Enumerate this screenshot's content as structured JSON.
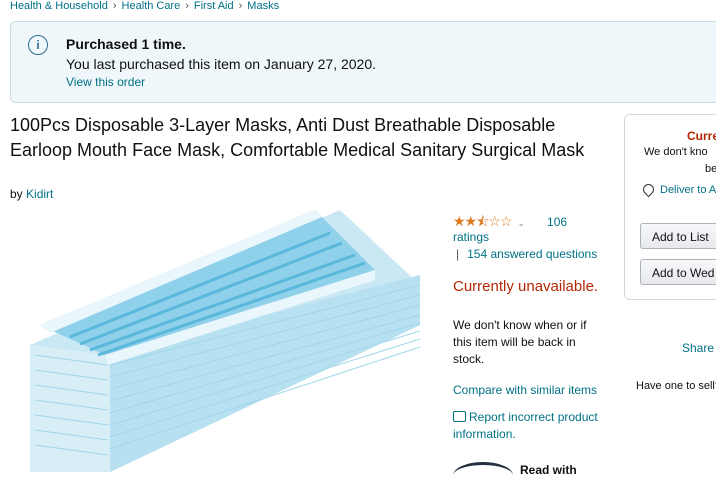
{
  "breadcrumb": [
    "Health & Household",
    "Health Care",
    "First Aid",
    "Masks"
  ],
  "notice": {
    "title": "Purchased 1 time.",
    "message": "You last purchased this item on January 27, 2020.",
    "link": "View this order"
  },
  "product": {
    "title": "100Pcs Disposable 3-Layer Masks, Anti Dust Breathable Disposable Earloop Mouth Face Mask, Comfortable Medical Sanitary Surgical Mask",
    "by_prefix": "by",
    "brand": "Kidirt",
    "rating": {
      "stars": 2.5,
      "stars_glyphs": "★★⯪☆☆",
      "count": "106",
      "count_label": "ratings"
    },
    "questions": "154 answered questions",
    "availability": "Currently unavailable.",
    "availability_msg": "We don't know when or if this item will be back in stock.",
    "compare_link": "Compare with similar items",
    "report_link": "Report incorrect product information."
  },
  "buybox": {
    "status": "Curre",
    "message_line1": "We don't kno",
    "message_line2": "be",
    "deliver": "Deliver to A",
    "add_to_list": "Add to List",
    "add_to_wedding": "Add to Wed"
  },
  "side": {
    "share": "Share",
    "have_one": "Have one to sell?"
  },
  "bottom": {
    "partial_text": "Read with"
  },
  "colors": {
    "link": "#007185",
    "alert": "#b12704",
    "star": "#de7921",
    "mask_blue": "#8fd0ea"
  }
}
